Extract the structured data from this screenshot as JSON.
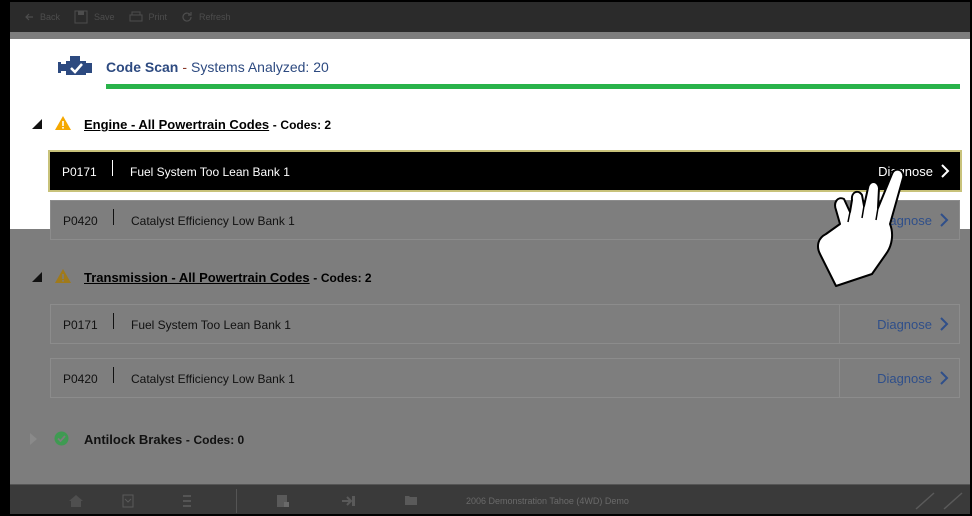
{
  "toolbar": {
    "items": [
      {
        "label": "Back",
        "icon": "back-arrow-icon"
      },
      {
        "label": "Save",
        "icon": "save-icon"
      },
      {
        "label": "Print",
        "icon": "print-icon"
      },
      {
        "label": "Refresh",
        "icon": "refresh-icon"
      }
    ]
  },
  "scan": {
    "title": "Code Scan",
    "separator": "-",
    "systems": "Systems Analyzed: 20",
    "progress": 1.0
  },
  "groups": [
    {
      "name": "Engine - All Powertrain Codes",
      "separator": "-",
      "codes_label": "Codes: 2",
      "rows": [
        {
          "code": "P0171",
          "desc": "Fuel System Too Lean Bank 1",
          "action": "Diagnose",
          "active": true
        },
        {
          "code": "P0420",
          "desc": "Catalyst Efficiency Low Bank 1",
          "action": "Diagnose",
          "active": false
        }
      ]
    },
    {
      "name": "Transmission - All Powertrain Codes",
      "separator": "-",
      "codes_label": "Codes: 2",
      "rows": [
        {
          "code": "P0171",
          "desc": "Fuel System Too Lean Bank 1",
          "action": "Diagnose",
          "active": false
        },
        {
          "code": "P0420",
          "desc": "Catalyst Efficiency Low Bank 1",
          "action": "Diagnose",
          "active": false
        }
      ]
    }
  ],
  "abs": {
    "name": "Antilock Brakes",
    "separator": "-",
    "codes_label": "Codes: 0"
  },
  "bottom": {
    "vehicle": "2006 Demonstration Tahoe (4WD) Demo"
  },
  "colors": {
    "accent": "#2d4a80",
    "progress": "#29b34a",
    "warning": "#f5a800",
    "ok": "#2db34a",
    "highlight_border": "#c8c27a"
  }
}
